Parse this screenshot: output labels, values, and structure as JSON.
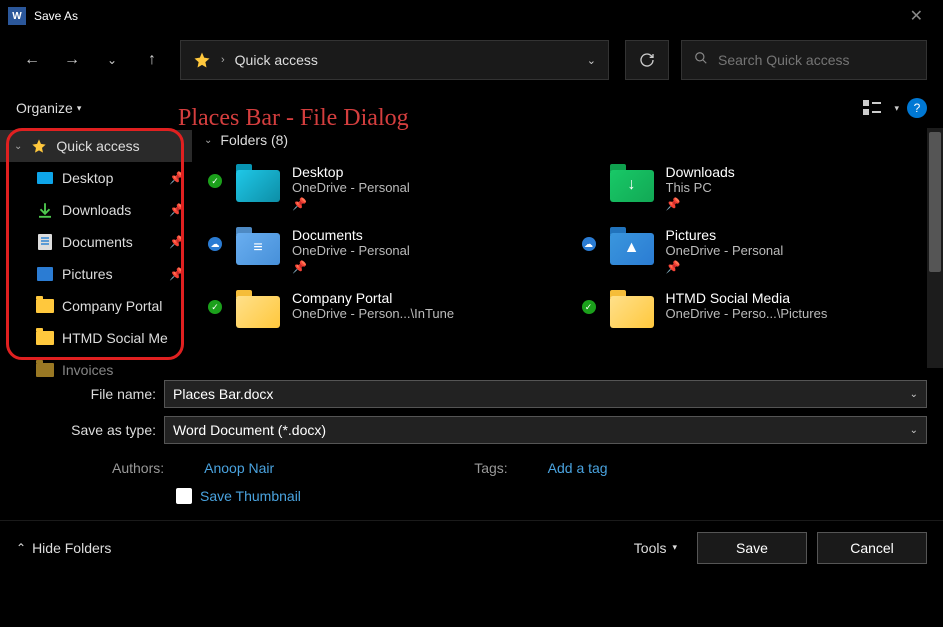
{
  "title": "Save As",
  "nav": {
    "address_icon": "star",
    "address_text": "Quick access",
    "search_placeholder": "Search Quick access"
  },
  "toolbar": {
    "organize": "Organize"
  },
  "annotation": "Places Bar - File Dialog",
  "sidebar": {
    "root": "Quick access",
    "items": [
      {
        "label": "Desktop",
        "icon": "desktop",
        "pinned": true
      },
      {
        "label": "Downloads",
        "icon": "download",
        "pinned": true
      },
      {
        "label": "Documents",
        "icon": "document",
        "pinned": true
      },
      {
        "label": "Pictures",
        "icon": "picture",
        "pinned": true
      },
      {
        "label": "Company Portal",
        "icon": "folder",
        "pinned": false
      },
      {
        "label": "HTMD Social Me",
        "icon": "folder",
        "pinned": false
      },
      {
        "label": "Invoices",
        "icon": "folder",
        "pinned": false
      }
    ]
  },
  "main": {
    "header": "Folders (8)",
    "folders": [
      {
        "name": "Desktop",
        "location": "OneDrive - Personal",
        "theme": "teal",
        "sync": "green",
        "pinned": true,
        "glyph": ""
      },
      {
        "name": "Downloads",
        "location": "This PC",
        "theme": "green",
        "sync": "",
        "pinned": true,
        "glyph": "↓"
      },
      {
        "name": "Documents",
        "location": "OneDrive - Personal",
        "theme": "blue",
        "sync": "blue",
        "pinned": true,
        "glyph": "≡"
      },
      {
        "name": "Pictures",
        "location": "OneDrive - Personal",
        "theme": "blue2",
        "sync": "blue",
        "pinned": true,
        "glyph": "▲"
      },
      {
        "name": "Company Portal",
        "location": "OneDrive - Person...\\InTune",
        "theme": "yellow",
        "sync": "green",
        "pinned": false,
        "glyph": ""
      },
      {
        "name": "HTMD Social Media",
        "location": "OneDrive - Perso...\\Pictures",
        "theme": "yellow",
        "sync": "green",
        "pinned": false,
        "glyph": ""
      }
    ]
  },
  "form": {
    "filename_label": "File name:",
    "filename_value": "Places Bar.docx",
    "type_label": "Save as type:",
    "type_value": "Word Document (*.docx)",
    "authors_label": "Authors:",
    "authors_value": "Anoop Nair",
    "tags_label": "Tags:",
    "tags_value": "Add a tag",
    "thumbnail_label": "Save Thumbnail"
  },
  "footer": {
    "hide_folders": "Hide Folders",
    "tools": "Tools",
    "save": "Save",
    "cancel": "Cancel"
  }
}
